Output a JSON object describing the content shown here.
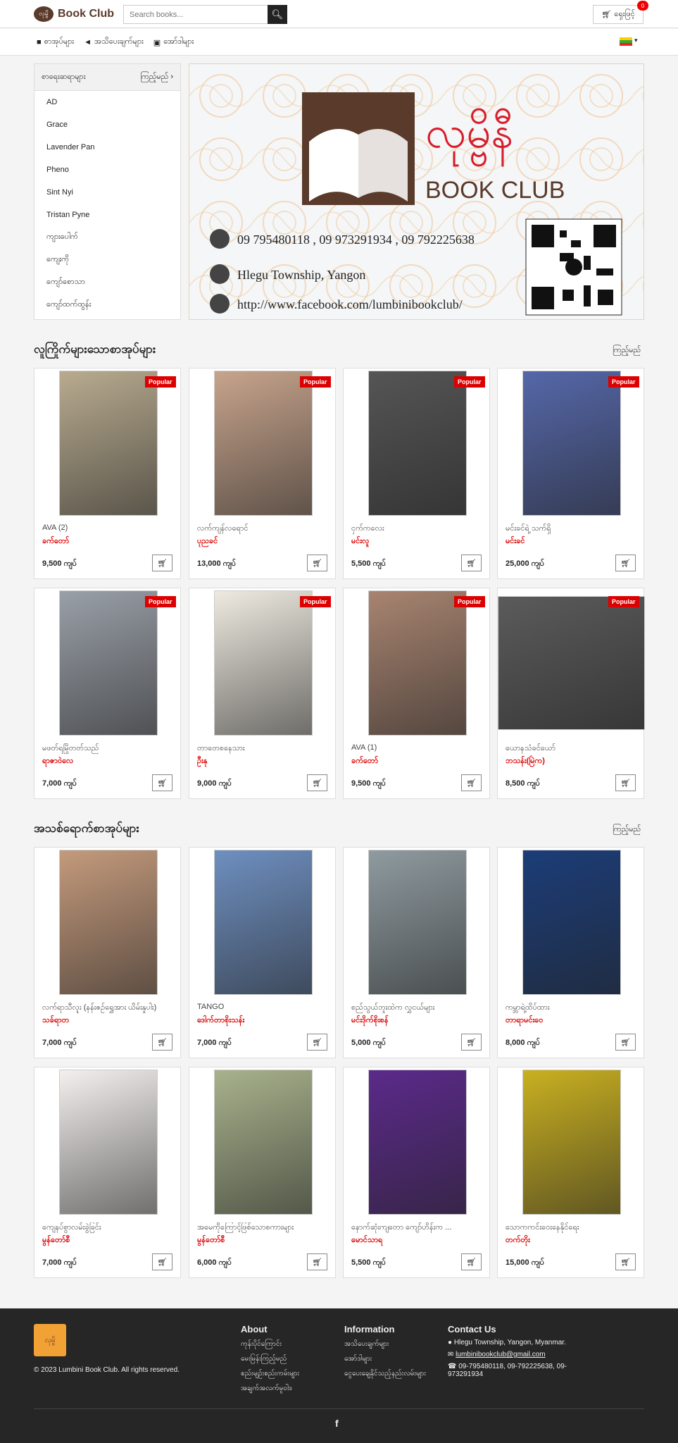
{
  "header": {
    "logo_mark": "လုမ္ဗိ",
    "logo_text": "Book Club",
    "search_placeholder": "Search books...",
    "cart_label": "ရှေးဖြင့်",
    "cart_count": "0"
  },
  "nav": {
    "items": [
      "စာအုပ်များ",
      "အသိပေးချက်များ",
      "အော်ဒါများ"
    ]
  },
  "sidebar": {
    "title": "စာရေးဆရာများ",
    "more": "ကြည့်မည်",
    "items": [
      "AD",
      "Grace",
      "Lavender Pan",
      "Pheno",
      "Sint Nyi",
      "Tristan Pyne",
      "ကျားပေါက်",
      "ကျေးကို",
      "ကျော်စောသာ",
      "ကျော်ထက်ထွန်း"
    ]
  },
  "banner": {
    "title": "လုမ္ဗိနီ",
    "subtitle": "BOOK CLUB",
    "phone": "09 795480118 , 09 973291934 , 09 792225638",
    "address": "Hlegu Township, Yangon",
    "url": "http://www.facebook.com/lumbinibookclub/"
  },
  "popular": {
    "title": "လူကြိုက်များသောစာအုပ်များ",
    "more": "ကြည့်မည်"
  },
  "latest": {
    "title": "အသစ်ရောက်စာအုပ်များ",
    "more": "ကြည့်မည်"
  },
  "badge": "Popular",
  "books": [
    {
      "title": "AVA (2)",
      "author": "ခက်တော်",
      "price": "9,500 ကျပ်",
      "color": "#b8ab8f"
    },
    {
      "title": "လက်ကျန်လရောင်",
      "author": "ပုညခင်",
      "price": "13,000 ကျပ်",
      "color": "#c7a48c"
    },
    {
      "title": "ငှက်ကလေး",
      "author": "မင်းလူ",
      "price": "5,500 ကျပ်",
      "color": "#555555"
    },
    {
      "title": "မင်းခင်ရဲ့ သက်ရှိ",
      "author": "မင်းခင်",
      "price": "25,000 ကျပ်",
      "color": "#5567a9"
    },
    {
      "title": "မဖတ်ရမြိုတတ်သည်",
      "author": "ရာဇာဝဲလေ",
      "price": "7,000 ကျပ်",
      "color": "#9aa0a8"
    },
    {
      "title": "တာတေစနေသား",
      "author": "ဦးနု",
      "price": "9,000 ကျပ်",
      "color": "#eeeae0"
    },
    {
      "title": "AVA (1)",
      "author": "ခက်တော်",
      "price": "9,500 ကျပ်",
      "color": "#a88470"
    },
    {
      "title": "ယောနသံခင်ယော်",
      "author": "ဘသန်း(မြဲက)",
      "price": "8,500 ကျပ်",
      "color": "#5b5b5b"
    },
    {
      "title": "လက်ရာသီလူး (နန်းဇဉ်ရွှေအား ယိမ်းနှုပါး)",
      "author": "သခ်ရာတ",
      "price": "7,000 ကျပ်",
      "color": "#c49a7c"
    },
    {
      "title": "TANGO",
      "author": "ဒေါက်တာစိုးသန်း",
      "price": "7,000 ကျပ်",
      "color": "#6e8fc0"
    },
    {
      "title": "စည်သွယ်ဘူးထဲက လွှငယ်များ",
      "author": "မင်းဒိုက်စိုးစန်",
      "price": "5,000 ကျပ်",
      "color": "#8f9ba0"
    },
    {
      "title": "ကမ္ဘာရဲ့ထိပ်ထား",
      "author": "တာရာမင်းဝေ",
      "price": "8,000 ကျပ်",
      "color": "#1c3d78"
    },
    {
      "title": "ကျေနပ်စွာလမ်းခွဲခြင်း",
      "author": "မွန်တော်စီ",
      "price": "7,000 ကျပ်",
      "color": "#f3f0ee"
    },
    {
      "title": "အမေကိုကြောင့်ဖြစ်သောစကားများ",
      "author": "မွန်တော်စီ",
      "price": "6,000 ကျပ်",
      "color": "#a8b28c"
    },
    {
      "title": "နောက်ဆုံးကျတော ကျော်ဟိန်းက ...",
      "author": "မောင်သာရ",
      "price": "5,500 ကျပ်",
      "color": "#5b2a8a"
    },
    {
      "title": "သောကကင်းဝေးနေနိုင်ရေး",
      "author": "တက်တိုး",
      "price": "15,000 ကျပ်",
      "color": "#c9b021"
    }
  ],
  "footer": {
    "logo": "လုမ္ဗိ",
    "copyright": "© 2023 Lumbini Book Club. All rights reserved.",
    "about_title": "About",
    "about_items": [
      "ကုန်းပိုင်ကြောင်း",
      "မေးမြန်းကြည့်မည်",
      "စည်းမျဉ်းစည်းကမ်းများ",
      "အချက်အလက်မူဝါဒ"
    ],
    "info_title": "Information",
    "info_items": [
      "အသိပေးချက်များ",
      "အော်ဒါများ",
      "ငွေပေးချေနိုင်သည့်နည်းလမ်းများ"
    ],
    "contact_title": "Contact Us",
    "address": "Hlegu Township, Yangon, Myanmar.",
    "email": "lumbinibookclub@gmail.com",
    "phone": "09-795480118, 09-792225638, 09-973291934",
    "fb": "f"
  }
}
